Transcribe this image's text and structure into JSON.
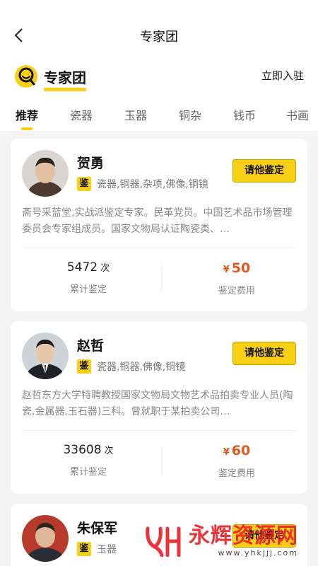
{
  "header": {
    "title": "专家团"
  },
  "brand": {
    "title": "专家团",
    "join_label": "立即入驻"
  },
  "tabs": [
    {
      "label": "推荐",
      "active": true
    },
    {
      "label": "瓷器"
    },
    {
      "label": "玉器"
    },
    {
      "label": "铜杂"
    },
    {
      "label": "钱币"
    },
    {
      "label": "书画"
    }
  ],
  "experts": [
    {
      "name": "贺勇",
      "badge": "鉴",
      "categories": "瓷器,铜器,杂项,佛像,铜镜",
      "button_label": "请他鉴定",
      "description": "斋号采蓝堂,实战派鉴定专家。民革党员。中国艺术品市场管理委员会专家组成员。国家文物局认证陶瓷类、…",
      "count_value": "5472",
      "count_unit": "次",
      "count_label": "累计鉴定",
      "price_symbol": "¥",
      "price_value": "50",
      "price_label": "鉴定费用"
    },
    {
      "name": "赵哲",
      "badge": "鉴",
      "categories": "瓷器,铜器,佛像,铜镜",
      "button_label": "请他鉴定",
      "description": "赵哲东方大学特聘教授国家文物局文物艺术品拍卖专业人员(陶瓷,金属器,玉石器)三科。曾就职于某拍卖公司…",
      "count_value": "33608",
      "count_unit": "次",
      "count_label": "累计鉴定",
      "price_symbol": "¥",
      "price_value": "60",
      "price_label": "鉴定费用"
    },
    {
      "name": "朱保军",
      "badge": "鉴",
      "categories": "玉器",
      "button_label": "请他鉴定"
    }
  ],
  "watermark": {
    "title": "永辉资源网",
    "url": "www.yhkjjj.com"
  },
  "colors": {
    "accent": "#f9cf15",
    "price": "#e05a1f",
    "background": "#f4f4f4"
  }
}
